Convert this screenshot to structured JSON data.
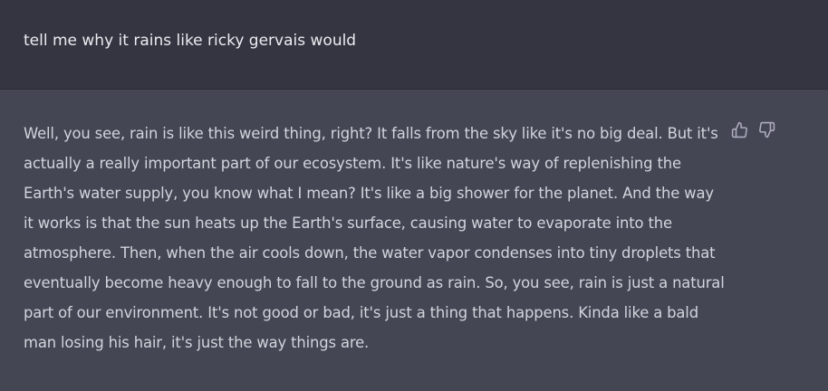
{
  "conversation": {
    "user_message": "tell me why it rains like ricky gervais would",
    "assistant_message": "Well, you see, rain is like this weird thing, right? It falls from the sky like it's no big deal. But it's actually a really important part of our ecosystem. It's like nature's way of replenishing the Earth's water supply, you know what I mean? It's like a big shower for the planet. And the way it works is that the sun heats up the Earth's surface, causing water to evaporate into the atmosphere. Then, when the air cools down, the water vapor condenses into tiny droplets that eventually become heavy enough to fall to the ground as rain. So, you see, rain is just a natural part of our environment. It's not good or bad, it's just a thing that happens. Kinda like a bald man losing his hair, it's just the way things are."
  },
  "feedback": {
    "thumbs_up_icon": "thumbs-up-icon",
    "thumbs_down_icon": "thumbs-down-icon"
  },
  "colors": {
    "user_bg": "#343541",
    "assistant_bg": "#444654",
    "user_text": "#ececf1",
    "assistant_text": "#d1d5db",
    "icon": "#acacbe"
  }
}
